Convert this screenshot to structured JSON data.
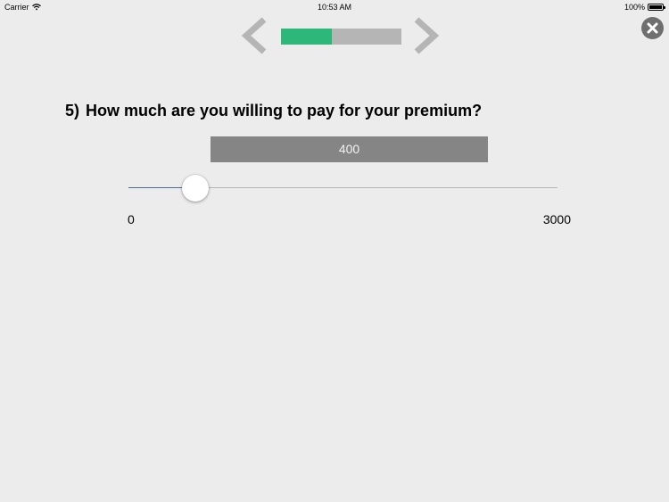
{
  "status_bar": {
    "carrier": "Carrier",
    "time": "10:53 AM",
    "battery": "100%"
  },
  "progress": {
    "fraction": 0.42,
    "fill_color": "#2db87a",
    "track_color": "#b5b5b5"
  },
  "question": {
    "number": "5)",
    "text": "How much are you willing to pay for your premium?"
  },
  "slider": {
    "value": 400,
    "value_label": "400",
    "min": 0,
    "max": 3000,
    "min_label": "0",
    "max_label": "3000"
  },
  "icons": {
    "close": "close-icon",
    "previous": "chevron-left-icon",
    "next": "chevron-right-icon",
    "wifi": "wifi-icon",
    "battery": "battery-icon"
  }
}
